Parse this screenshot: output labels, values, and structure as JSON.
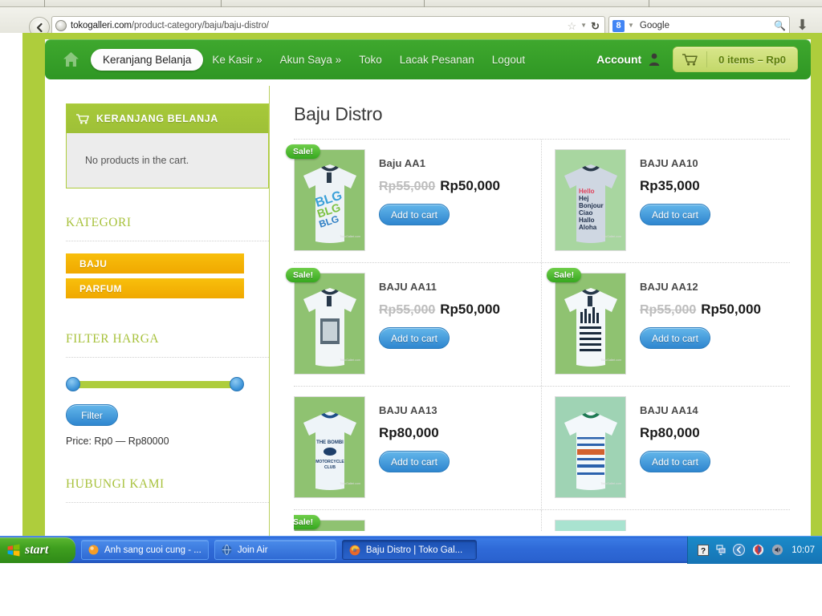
{
  "browser": {
    "url_domain": "tokogalleri.com",
    "url_path": "/product-category/baju/baju-distro/",
    "search_engine": "Google",
    "g_letter": "8",
    "icons": {
      "back": "back-arrow-icon",
      "favicon": "site-favicon",
      "bookmark": "star-icon",
      "dropdown": "chevron-down-icon",
      "reload": "reload-icon",
      "search": "magnifier-icon",
      "download": "download-arrow-icon"
    }
  },
  "site": {
    "nav": {
      "home_icon": "home-icon",
      "items": [
        {
          "label": "Keranjang Belanja",
          "active": true
        },
        {
          "label": "Ke Kasir »",
          "active": false
        },
        {
          "label": "Akun Saya »",
          "active": false
        },
        {
          "label": "Toko",
          "active": false
        },
        {
          "label": "Lacak Pesanan",
          "active": false
        },
        {
          "label": "Logout",
          "active": false
        }
      ],
      "account_label": "Account",
      "cart_label": "0 items – Rp0"
    },
    "sidebar": {
      "cart_widget": {
        "title": "KERANJANG BELANJA",
        "empty_text": "No products in the cart."
      },
      "kategori": {
        "title": "KATEGORI",
        "items": [
          {
            "label": "BAJU"
          },
          {
            "label": "PARFUM"
          }
        ]
      },
      "filter_harga": {
        "title": "FILTER HARGA",
        "button_label": "Filter",
        "price_text": "Price: Rp0 — Rp80000",
        "slider_min": 0,
        "slider_max": 80000
      },
      "hubungi_kami": {
        "title": "HUBUNGI KAMI"
      }
    },
    "main": {
      "page_title": "Baju Distro",
      "add_to_cart_label": "Add to cart",
      "sale_badge_label": "Sale!",
      "products": [
        {
          "name": "Baju AA1",
          "old_price": "Rp55,000",
          "price": "Rp50,000",
          "on_sale": true,
          "img": "tee-blue-graphic"
        },
        {
          "name": "BAJU AA10",
          "old_price": "",
          "price": "Rp35,000",
          "on_sale": false,
          "img": "tee-hello-bonjour"
        },
        {
          "name": "BAJU AA11",
          "old_price": "Rp55,000",
          "price": "Rp50,000",
          "on_sale": true,
          "img": "tee-photo-print"
        },
        {
          "name": "BAJU AA12",
          "old_price": "Rp55,000",
          "price": "Rp50,000",
          "on_sale": true,
          "img": "tee-city-stripes"
        },
        {
          "name": "BAJU AA13",
          "old_price": "",
          "price": "Rp80,000",
          "on_sale": false,
          "img": "tee-bombi-club"
        },
        {
          "name": "BAJU AA14",
          "old_price": "",
          "price": "Rp80,000",
          "on_sale": false,
          "img": "tee-blue-stripes"
        }
      ],
      "watermark": "TokoGalleri.com"
    },
    "colors": {
      "lime": "#aecd3c",
      "nav_green": "#3fa82e",
      "orange": "#f4b000",
      "blue_button": "#2f86cf",
      "sale_green": "#36a81f"
    }
  },
  "taskbar": {
    "start_label": "start",
    "items": [
      {
        "label": "Anh sang cuoi cung - ...",
        "active": false,
        "icon": "orange-circle-icon"
      },
      {
        "label": "Join Air",
        "active": false,
        "icon": "blue-globe-icon"
      },
      {
        "label": "Baju Distro | Toko Gal...",
        "active": true,
        "icon": "firefox-icon"
      }
    ],
    "tray": {
      "icons": [
        "help-icon",
        "network-icon",
        "show-hidden-icon",
        "antivirus-icon",
        "volume-icon"
      ],
      "clock": "10:07"
    }
  }
}
